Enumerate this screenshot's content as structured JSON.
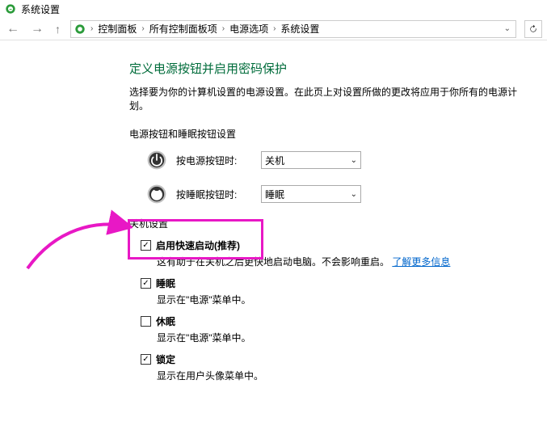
{
  "titlebar": {
    "title": "系统设置"
  },
  "breadcrumb": {
    "items": [
      "控制面板",
      "所有控制面板项",
      "电源选项",
      "系统设置"
    ]
  },
  "page": {
    "heading": "定义电源按钮并启用密码保护",
    "desc": "选择要为你的计算机设置的电源设置。在此页上对设置所做的更改将应用于你所有的电源计划。",
    "section_buttons_title": "电源按钮和睡眠按钮设置",
    "power_button": {
      "label": "按电源按钮时:",
      "value": "关机"
    },
    "sleep_button": {
      "label": "按睡眠按钮时:",
      "value": "睡眠"
    },
    "shutdown_heading": "关机设置",
    "options": {
      "fast_startup": {
        "label": "启用快速启动(推荐)",
        "sub_pre": "这有助于在关机之后更快地启动电脑。不会影响重启。",
        "link": "了解更多信息"
      },
      "sleep": {
        "label": "睡眠",
        "sub": "显示在\"电源\"菜单中。"
      },
      "hibernate": {
        "label": "休眠",
        "sub": "显示在\"电源\"菜单中。"
      },
      "lock": {
        "label": "锁定",
        "sub": "显示在用户头像菜单中。"
      }
    }
  }
}
